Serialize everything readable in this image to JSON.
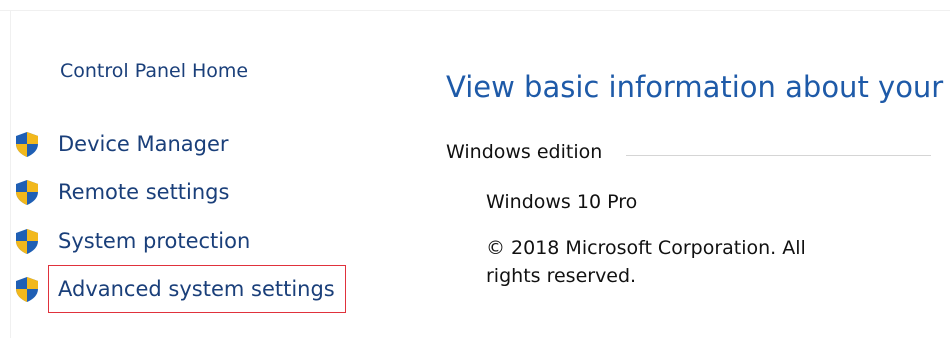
{
  "sidebar": {
    "home_link": "Control Panel Home",
    "tasks": [
      {
        "label": "Device Manager",
        "icon": "uac-shield-icon"
      },
      {
        "label": "Remote settings",
        "icon": "uac-shield-icon"
      },
      {
        "label": "System protection",
        "icon": "uac-shield-icon"
      },
      {
        "label": "Advanced system settings",
        "icon": "uac-shield-icon",
        "highlighted": true
      }
    ]
  },
  "main": {
    "title": "View basic information about your",
    "windows_edition": {
      "heading": "Windows edition",
      "edition_name": "Windows 10 Pro",
      "copyright_line1": "© 2018 Microsoft Corporation. All",
      "copyright_line2": "rights reserved."
    }
  },
  "colors": {
    "link": "#1a3f7a",
    "title": "#1e5aa8",
    "highlight": "#e0323c",
    "shield_blue": "#1f5fb4",
    "shield_yellow": "#f2b81c"
  }
}
